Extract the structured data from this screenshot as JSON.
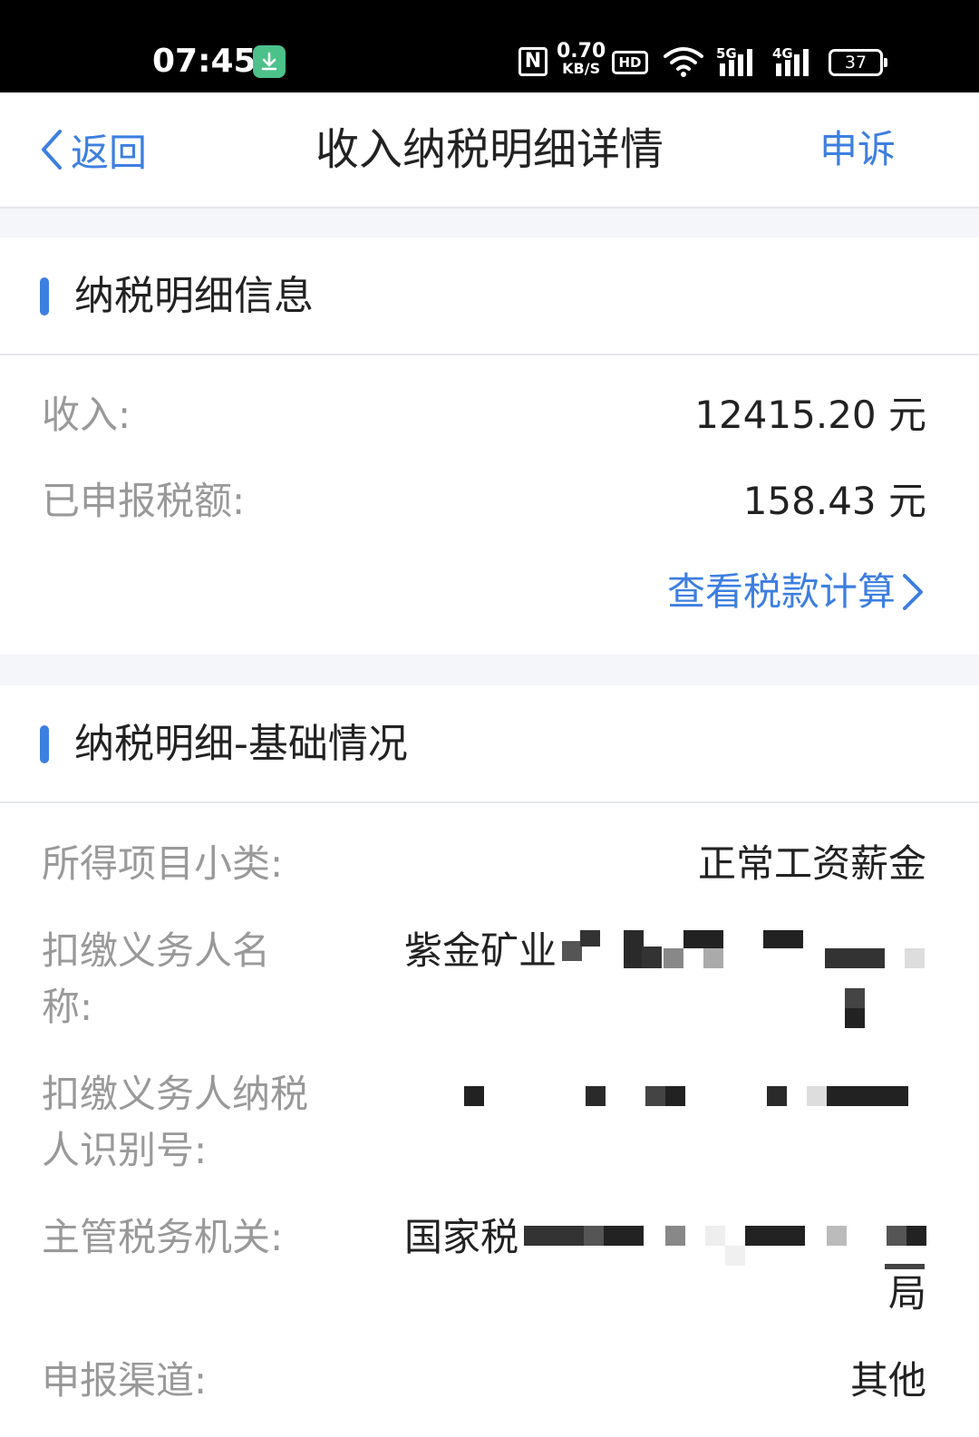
{
  "status_bar": {
    "time": "07:45",
    "net_speed_value": "0.70",
    "net_speed_unit": "KB/S",
    "hd_label": "HD",
    "sig1_label": "5G",
    "sig2_label": "4G",
    "wifi_sub": "5",
    "battery": "37",
    "nfc": "N"
  },
  "nav": {
    "back_label": "返回",
    "title": "收入纳税明细详情",
    "appeal_label": "申诉"
  },
  "section1": {
    "title": "纳税明细信息",
    "income_label": "收入:",
    "income_value": "12415.20 元",
    "tax_label": "已申报税额:",
    "tax_value": "158.43 元",
    "calc_link": "查看税款计算"
  },
  "section2": {
    "title": "纳税明细-基础情况",
    "item_label": "所得项目小类:",
    "item_value": "正常工资薪金",
    "payer_name_label_l1": "扣缴义务人名",
    "payer_name_label_l2": "称:",
    "payer_name_value": "紫金矿业",
    "payer_id_label_l1": "扣缴义务人纳税",
    "payer_id_label_l2": "人识别号:",
    "authority_label": "主管税务机关:",
    "authority_value_start": "国家税",
    "authority_value_end": "局",
    "channel_label": "申报渠道:",
    "channel_value": "其他"
  }
}
